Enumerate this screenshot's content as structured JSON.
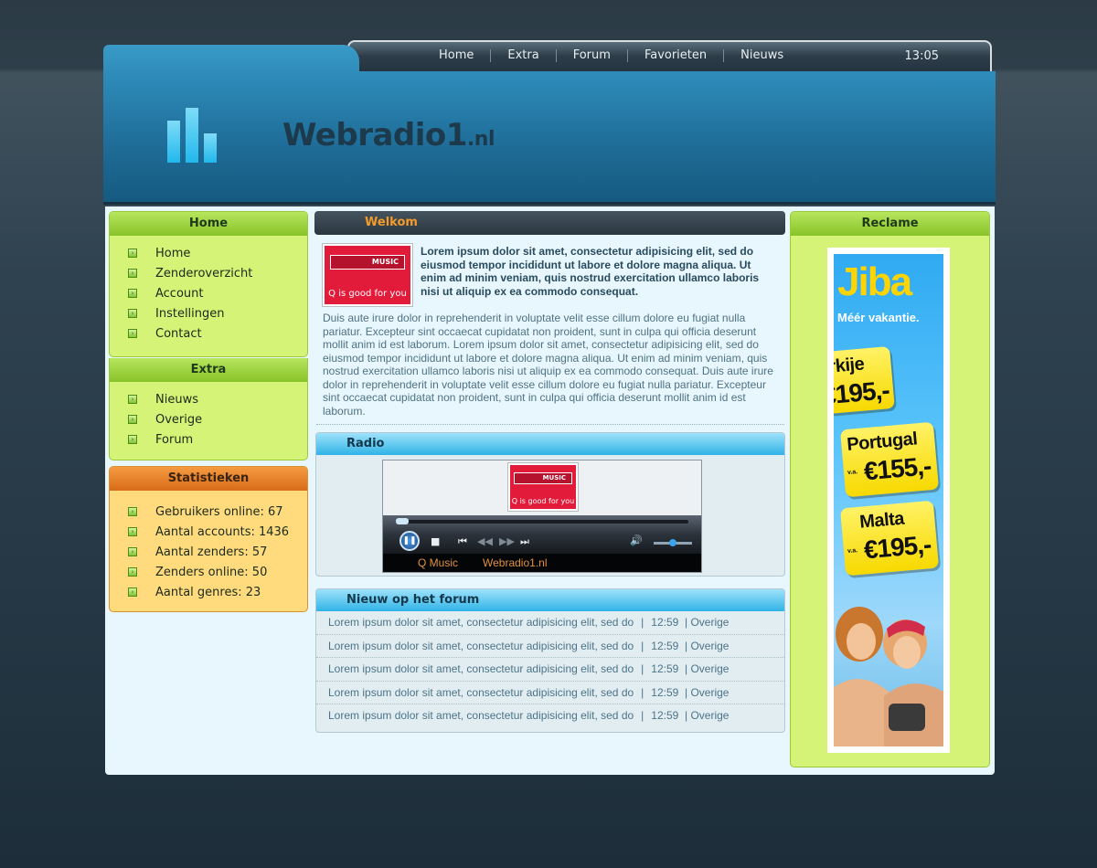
{
  "nav": {
    "items": [
      "Home",
      "Extra",
      "Forum",
      "Favorieten",
      "Nieuws"
    ],
    "clock": "13:05"
  },
  "logo": {
    "name": "Webradio1",
    "tld": ".nl"
  },
  "left": {
    "home": {
      "title": "Home",
      "items": [
        "Home",
        "Zenderoverzicht",
        "Account",
        "Instellingen",
        "Contact"
      ]
    },
    "extra": {
      "title": "Extra",
      "items": [
        "Nieuws",
        "Overige",
        "Forum"
      ]
    },
    "stats": {
      "title": "Statistieken",
      "items": [
        "Gebruikers online: 67",
        "Aantal accounts: 1436",
        "Aantal zenders: 57",
        "Zenders online: 50",
        "Aantal genres: 23"
      ]
    }
  },
  "welcome": {
    "title": "Welkom",
    "logo_top": "MUSIC",
    "logo_bottom": "Q is good for you",
    "intro": "Lorem ipsum dolor sit amet, consectetur adipisicing elit, sed do eiusmod tempor incididunt ut labore et dolore magna aliqua. Ut enim ad minim veniam, quis nostrud exercitation ullamco laboris nisi ut aliquip ex ea commodo consequat.",
    "body": "Duis aute irure dolor in reprehenderit in voluptate velit esse cillum dolore eu fugiat nulla pariatur. Excepteur sint occaecat cupidatat non proident, sunt in culpa qui officia deserunt mollit anim id est laborum. Lorem ipsum dolor sit amet, consectetur adipisicing elit, sed do eiusmod tempor incididunt ut labore et dolore magna aliqua. Ut enim ad minim veniam, quis nostrud exercitation ullamco laboris nisi ut aliquip ex ea commodo consequat. Duis aute irure dolor in reprehenderit in voluptate velit esse cillum dolore eu fugiat nulla pariatur. Excepteur sint occaecat cupidatat non proident, sunt in culpa qui officia deserunt mollit anim id est laborum."
  },
  "radio": {
    "title": "Radio",
    "logo_top": "MUSIC",
    "logo_bottom": "Q is good for you",
    "station": "Q Music",
    "site": "Webradio1.nl",
    "progress": 0,
    "volume": 0.5
  },
  "forum": {
    "title": "Nieuw op het forum",
    "rows": [
      {
        "text": "Lorem ipsum dolor sit amet, consectetur adipisicing elit, sed do",
        "sep": "|",
        "time": "12:59",
        "category": "| Overige"
      },
      {
        "text": "Lorem ipsum dolor sit amet, consectetur adipisicing elit, sed do",
        "sep": "|",
        "time": "12:59",
        "category": "| Overige"
      },
      {
        "text": "Lorem ipsum dolor sit amet, consectetur adipisicing elit, sed do",
        "sep": "|",
        "time": "12:59",
        "category": "| Overige"
      },
      {
        "text": "Lorem ipsum dolor sit amet, consectetur adipisicing elit, sed do",
        "sep": "|",
        "time": "12:59",
        "category": "| Overige"
      },
      {
        "text": "Lorem ipsum dolor sit amet, consectetur adipisicing elit, sed do",
        "sep": "|",
        "time": "12:59",
        "category": "| Overige"
      }
    ]
  },
  "ads": {
    "title": "Reclame",
    "brand": "Jiba",
    "tagline": "Méér vakantie.",
    "deals": [
      {
        "dest": "rkije",
        "price": "€195,-"
      },
      {
        "dest": "Portugal",
        "va": "v.a.",
        "price": "€155,-"
      },
      {
        "dest": "Malta",
        "va": "v.a.",
        "price": "€195,-"
      }
    ]
  },
  "colors": {
    "accent_orange": "#f49a2a",
    "menu_green": "#d5f376",
    "stats_orange": "#ffdb7e",
    "header_blue": "#1e6b96"
  }
}
